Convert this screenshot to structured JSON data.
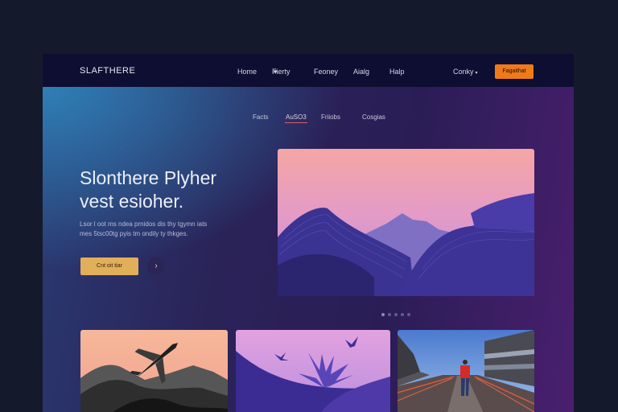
{
  "header": {
    "logo": "SLAFTHERE",
    "nav": [
      "Home",
      "Fierty",
      "Feoney",
      "Aialg",
      "Halp"
    ],
    "country": "Conky",
    "cta": "Fagaithat"
  },
  "subnav": {
    "items": [
      "Facts",
      "AuSO3",
      "Friiobs",
      "Cosgias"
    ],
    "active_index": 1
  },
  "hero": {
    "headline_line1": "Slonthere Plyher",
    "headline_line2": "vest esioher.",
    "body_line1": "Lsor l oot ms ndea prnidos dis thy tgymn iats",
    "body_line2": "mes 5tsc00tg pyis tm ondily ty thkges.",
    "cta": "Cnt oit tiar"
  },
  "carousel": {
    "dot_count": 5,
    "active_dot": 0
  },
  "icons": {
    "nav_dropdown": "chevron-down-icon",
    "hero_arrow": "chevron-right-icon"
  },
  "colors": {
    "accent_orange": "#f07a1a",
    "accent_gold": "#e1ae5a",
    "navbar": "#0e0e32",
    "page_bg": "#141a2c",
    "active_underline": "#e45a6a"
  }
}
